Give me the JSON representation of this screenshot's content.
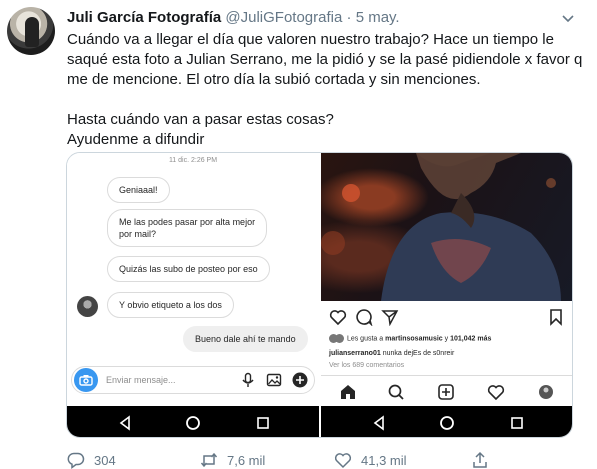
{
  "tweet": {
    "author_name": "Juli García Fotografía",
    "handle": "@JuliGFotografia",
    "separator": "·",
    "date": "5 may.",
    "paragraph1": "Cuándo va a llegar el día que valoren nuestro trabajo? Hace un tiempo le\nsaqué esta foto a Julian Serrano, me la pidió y se la pasé pidiendole x favor q\nme de mencione. El otro día la subió cortada y sin menciones.",
    "paragraph2": "Hasta cuándo van a pasar estas cosas?\nAyudenme a difundir"
  },
  "dm_screenshot": {
    "timestamp": "11 dic. 2:26 PM",
    "messages": [
      {
        "text": "Geniaaal!"
      },
      {
        "text": "Me las podes pasar por alta mejor\npor mail?"
      },
      {
        "text": "Quizás las subo de posteo por eso"
      },
      {
        "text": "Y obvio etiqueto a los dos"
      },
      {
        "text": "Bueno dale ahí te mando"
      }
    ],
    "composer_placeholder": "Enviar mensaje..."
  },
  "ig_screenshot": {
    "likes_prefix": "Les gusta a",
    "likes_user": "martinsosamusic",
    "likes_joiner": "y",
    "likes_count": "101,042 más",
    "caption_user": "julianserrano01",
    "caption_text": "nunka dejEs de s0nreir ",
    "comments_link": "Ver los 689 comentarios"
  },
  "actions": {
    "replies": "304",
    "retweets": "7,6 mil",
    "likes": "41,3 mil"
  },
  "colors": {
    "secondary_text": "#657786",
    "ig_blue": "#3897f0"
  }
}
